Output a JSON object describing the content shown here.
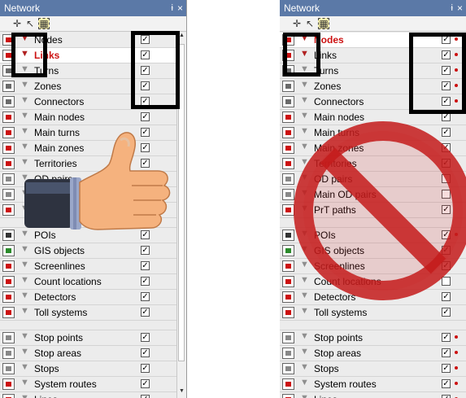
{
  "panels": [
    {
      "title": "Network",
      "controls": {
        "pin": "ɨ",
        "close": "×"
      },
      "rows": [
        {
          "label": "Nodes",
          "color": "#cc1111",
          "checked": true
        },
        {
          "label": "Links",
          "color": "#cc1111",
          "checked": true,
          "bold": true,
          "highlighted": true
        },
        {
          "label": "Turns",
          "color": "#6a6a6a",
          "checked": true
        },
        {
          "label": "Zones",
          "color": "#6a6a6a",
          "checked": true
        },
        {
          "label": "Connectors",
          "color": "#6a6a6a",
          "checked": true
        },
        {
          "label": "Main nodes",
          "color": "#cc1111",
          "checked": true
        },
        {
          "label": "Main turns",
          "color": "#cc1111",
          "checked": true
        },
        {
          "label": "Main zones",
          "color": "#cc1111",
          "checked": true
        },
        {
          "label": "Territories",
          "color": "#cc1111",
          "checked": true
        },
        {
          "label": "OD pairs",
          "color": "#888888",
          "checked": true
        },
        {
          "label": "Main OD pairs",
          "color": "#888888",
          "checked": true
        },
        {
          "label": "PrT paths",
          "color": "#cc1111",
          "checked": true
        },
        {
          "label": "",
          "color": "#d0d0d0",
          "checked": false,
          "separator": true
        },
        {
          "label": "POIs",
          "color": "#333333",
          "checked": true
        },
        {
          "label": "GIS objects",
          "color": "#2a8a2a",
          "checked": true
        },
        {
          "label": "Screenlines",
          "color": "#cc1111",
          "checked": true
        },
        {
          "label": "Count locations",
          "color": "#cc1111",
          "checked": true
        },
        {
          "label": "Detectors",
          "color": "#cc1111",
          "checked": true
        },
        {
          "label": "Toll systems",
          "color": "#cc1111",
          "checked": true
        },
        {
          "label": "",
          "color": "#d0d0d0",
          "checked": false,
          "separator": true
        },
        {
          "label": "Stop points",
          "color": "#888888",
          "checked": true
        },
        {
          "label": "Stop areas",
          "color": "#888888",
          "checked": true
        },
        {
          "label": "Stops",
          "color": "#888888",
          "checked": true
        },
        {
          "label": "System routes",
          "color": "#cc1111",
          "checked": true
        },
        {
          "label": "Lines",
          "color": "#cc1111",
          "checked": true
        }
      ]
    },
    {
      "title": "Network",
      "controls": {
        "pin": "ɨ",
        "close": "×"
      },
      "rows": [
        {
          "label": "Nodes",
          "color": "#cc1111",
          "checked": true,
          "bold": true,
          "highlighted": true,
          "dot": true
        },
        {
          "label": "Links",
          "color": "#cc1111",
          "checked": true,
          "dot": true
        },
        {
          "label": "Turns",
          "color": "#6a6a6a",
          "checked": true,
          "dot": true
        },
        {
          "label": "Zones",
          "color": "#6a6a6a",
          "checked": true,
          "dot": true
        },
        {
          "label": "Connectors",
          "color": "#6a6a6a",
          "checked": true,
          "dot": true
        },
        {
          "label": "Main nodes",
          "color": "#cc1111",
          "checked": true
        },
        {
          "label": "Main turns",
          "color": "#cc1111",
          "checked": true
        },
        {
          "label": "Main zones",
          "color": "#cc1111",
          "checked": true
        },
        {
          "label": "Territories",
          "color": "#cc1111",
          "checked": true
        },
        {
          "label": "OD pairs",
          "color": "#888888",
          "checked": false
        },
        {
          "label": "Main OD pairs",
          "color": "#888888",
          "checked": false
        },
        {
          "label": "PrT paths",
          "color": "#cc1111",
          "checked": true
        },
        {
          "label": "",
          "color": "#d0d0d0",
          "checked": false,
          "separator": true
        },
        {
          "label": "POIs",
          "color": "#333333",
          "checked": true,
          "dot": true
        },
        {
          "label": "GIS objects",
          "color": "#2a8a2a",
          "checked": true
        },
        {
          "label": "Screenlines",
          "color": "#cc1111",
          "checked": true
        },
        {
          "label": "Count locations",
          "color": "#cc1111",
          "checked": false
        },
        {
          "label": "Detectors",
          "color": "#cc1111",
          "checked": true
        },
        {
          "label": "Toll systems",
          "color": "#cc1111",
          "checked": true
        },
        {
          "label": "",
          "color": "#d0d0d0",
          "checked": false,
          "separator": true
        },
        {
          "label": "Stop points",
          "color": "#888888",
          "checked": true,
          "dot": true
        },
        {
          "label": "Stop areas",
          "color": "#888888",
          "checked": true,
          "dot": true
        },
        {
          "label": "Stops",
          "color": "#888888",
          "checked": true,
          "dot": true
        },
        {
          "label": "System routes",
          "color": "#cc1111",
          "checked": true,
          "dot": true
        },
        {
          "label": "Lines",
          "color": "#cc1111",
          "checked": true,
          "dot": true
        }
      ]
    }
  ],
  "icons": {
    "toolbar": [
      "add-icon",
      "pointer-icon",
      "select-rect-icon"
    ],
    "overlays": [
      "thumbs-up-icon",
      "prohibited-sign-icon"
    ]
  },
  "colors": {
    "titlebar": "#5b79a7",
    "accent_red": "#cc1111",
    "prohibited_red": "#c41b1b"
  }
}
